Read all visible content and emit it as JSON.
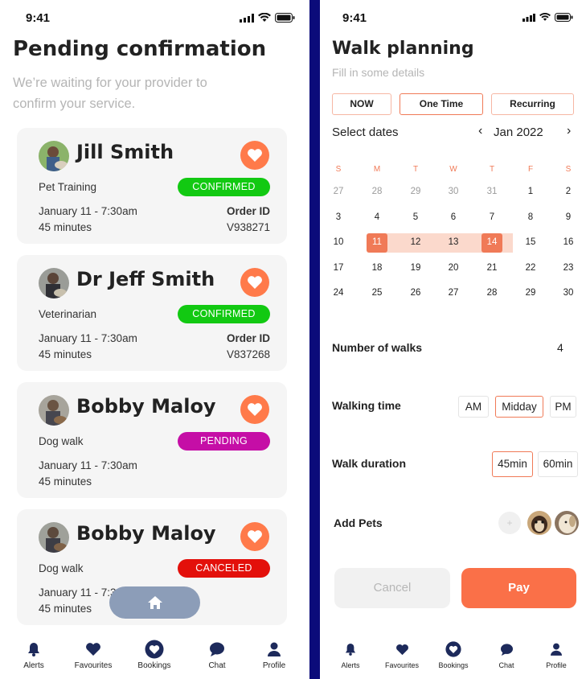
{
  "left": {
    "status_time": "9:41",
    "title": "Pending confirmation",
    "subtitle_line1": "We’re waiting for your provider to",
    "subtitle_line2": "confirm your service.",
    "cards": [
      {
        "name": "Jill Smith",
        "service": "Pet Training",
        "status": "CONFIRMED",
        "status_color": "#12c912",
        "date": "January 11 - 7:30am",
        "duration": "45 minutes",
        "order_label": "Order ID",
        "order_id": "V938271"
      },
      {
        "name": "Dr Jeff Smith",
        "service": "Veterinarian",
        "status": "CONFIRMED",
        "status_color": "#12c912",
        "date": "January 11 - 7:30am",
        "duration": "45 minutes",
        "order_label": "Order ID",
        "order_id": "V837268"
      },
      {
        "name": "Bobby Maloy",
        "service": "Dog walk",
        "status": "PENDING",
        "status_color": "#c50ea6",
        "date": "January 11 - 7:30am",
        "duration": "45 minutes"
      },
      {
        "name": "Bobby Maloy",
        "service": "Dog walk",
        "status": "CANCELED",
        "status_color": "#e3100b",
        "date": "January 11 - 7:30am",
        "duration": "45 minutes"
      }
    ],
    "tabs": [
      "Alerts",
      "Favourites",
      "Bookings",
      "Chat",
      "Profile"
    ]
  },
  "right": {
    "status_time": "9:41",
    "title": "Walk planning",
    "subtitle": "Fill in some details",
    "modes": [
      "NOW",
      "One Time",
      "Recurring"
    ],
    "active_mode": "One Time",
    "select_dates": "Select dates",
    "month": "Jan 2022",
    "prev": "‹",
    "next": "›",
    "weekdays": [
      "S",
      "M",
      "T",
      "W",
      "T",
      "F",
      "S"
    ],
    "weeks": [
      [
        "27",
        "28",
        "29",
        "30",
        "31",
        "1",
        "2"
      ],
      [
        "3",
        "4",
        "5",
        "6",
        "7",
        "8",
        "9"
      ],
      [
        "10",
        "11",
        "12",
        "13",
        "14",
        "15",
        "16"
      ],
      [
        "17",
        "18",
        "19",
        "20",
        "21",
        "22",
        "23"
      ],
      [
        "24",
        "25",
        "26",
        "27",
        "28",
        "29",
        "30"
      ]
    ],
    "range_start": "11",
    "range_end": "14",
    "num_walks_label": "Number of walks",
    "num_walks": "4",
    "walk_time_label": "Walking time",
    "walk_times": [
      "AM",
      "Midday",
      "PM"
    ],
    "walk_time_selected": "Midday",
    "duration_label": "Walk duration",
    "durations": [
      "45min",
      "60min"
    ],
    "duration_selected": "45min",
    "add_pets_label": "Add Pets",
    "add_pet_symbol": "+",
    "cancel": "Cancel",
    "pay": "Pay",
    "tabs": [
      "Alerts",
      "Favourites",
      "Bookings",
      "Chat",
      "Profile"
    ]
  },
  "colors": {
    "accent": "#fa7048",
    "nav_icon": "#1d2a5b"
  }
}
